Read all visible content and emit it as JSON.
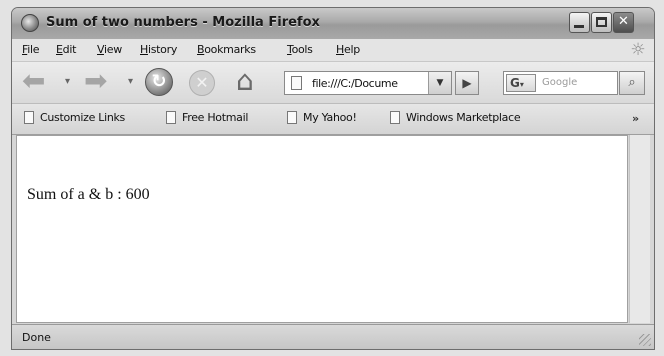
{
  "window": {
    "title": "Sum of two numbers - Mozilla Firefox",
    "min_icon": "minimize-icon",
    "max_icon": "maximize-icon",
    "close_label": "✕"
  },
  "menu": {
    "items": [
      "File",
      "Edit",
      "View",
      "History",
      "Bookmarks",
      "Tools",
      "Help"
    ]
  },
  "navigation": {
    "url": "file:///C:/Documents",
    "url_visible": "file:///C:/Docume",
    "search_engine": "G",
    "search_placeholder": "Google"
  },
  "bookmarks": {
    "items": [
      "Customize Links",
      "Free Hotmail",
      "My Yahoo!",
      "Windows Marketplace"
    ],
    "more": "»"
  },
  "page": {
    "text": "Sum of a & b : 600"
  },
  "status": {
    "text": "Done"
  }
}
